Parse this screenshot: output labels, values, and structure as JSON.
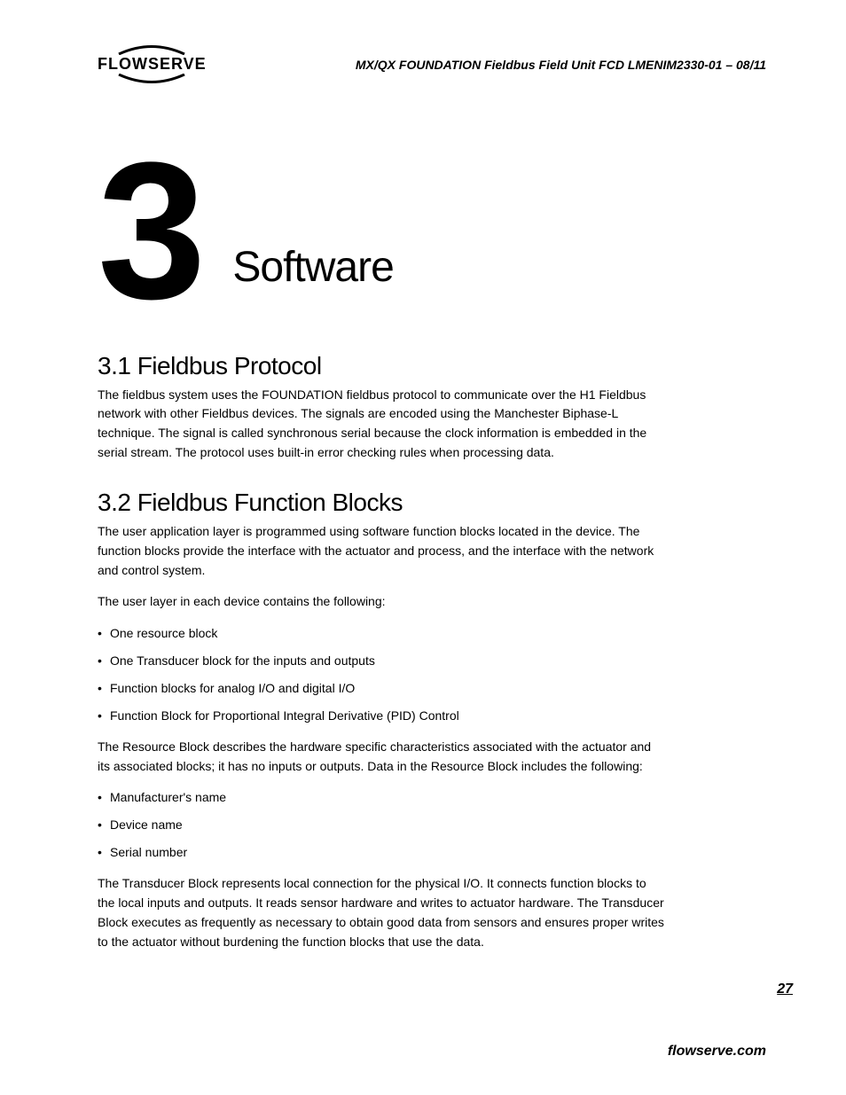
{
  "header": {
    "logo_text": "FLOWSERVE",
    "doc_title": "MX/QX FOUNDATION Fieldbus Field Unit   FCD LMENIM2330-01 – 08/11"
  },
  "chapter": {
    "number": "3",
    "title": "Software"
  },
  "sections": {
    "s1": {
      "heading": "3.1 Fieldbus Protocol",
      "p1": "The fieldbus system uses the FOUNDATION fieldbus protocol to communicate over the H1 Fieldbus network with other Fieldbus devices. The signals are encoded using the Manchester Biphase-L technique. The signal is called synchronous serial because the clock information is embedded in the serial stream. The protocol uses built-in error checking rules when processing data."
    },
    "s2": {
      "heading": "3.2 Fieldbus Function Blocks",
      "p1": "The user application layer is programmed using software function blocks located in the device. The function blocks provide the interface with the actuator and process, and the interface with the network and control system.",
      "p2": "The user layer in each device contains the following:",
      "list1": {
        "i0": "One resource block",
        "i1": "One Transducer block for the inputs and outputs",
        "i2": "Function blocks for analog I/O and digital I/O",
        "i3": "Function Block for Proportional Integral Derivative (PID) Control"
      },
      "p3": "The Resource Block describes the hardware specific characteristics associated with the actuator and its associated blocks; it has no inputs or outputs. Data in the Resource Block includes the following:",
      "list2": {
        "i0": "Manufacturer's name",
        "i1": "Device name",
        "i2": "Serial number"
      },
      "p4": "The Transducer Block represents local connection for the physical I/O. It connects function blocks to the local inputs and outputs. It reads sensor hardware and writes to actuator hardware. The Transducer Block executes as frequently as necessary to obtain good data from sensors and ensures proper writes to the actuator without burdening the function blocks that use the data."
    }
  },
  "footer": {
    "page_number": "27",
    "url": "flowserve.com"
  }
}
